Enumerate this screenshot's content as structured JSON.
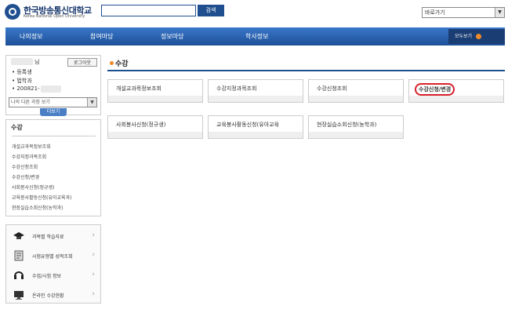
{
  "header": {
    "logo_title": "한국방송통신대학교",
    "logo_subtitle": "Korea National Open University",
    "search_button": "검색",
    "search_placeholder": "",
    "shortcut_select": "바로가기"
  },
  "nav": {
    "items": [
      "나의정보",
      "참여마당",
      "정보마당",
      "학사정보"
    ],
    "view_all": "모두보기"
  },
  "user": {
    "name_suffix": "님",
    "logout": "로그아웃",
    "info": [
      "• 등록생",
      "• 법학과",
      "• 200821-"
    ],
    "other_course_select": "나의 다른 과정 보기",
    "more": "더보기"
  },
  "left_menu": {
    "title": "수강",
    "items": [
      "개설교과목정보조회",
      "수강지정과목조회",
      "수강신청조회",
      "수강신청/변경",
      "사회봉사신청(정규생)",
      "교육봉사활동신청(유아교육과)",
      "현장실습소회신청(농학과)"
    ]
  },
  "quick_links": [
    {
      "label": "과목별 학습자료",
      "icon": "graduation-cap-icon"
    },
    {
      "label": "시험유형별 성적조회",
      "icon": "exam-paper-icon"
    },
    {
      "label": "수업/시험 정보",
      "icon": "headset-icon"
    },
    {
      "label": "온라인 수강현황",
      "icon": "monitor-icon"
    }
  ],
  "main": {
    "section_title": "수강",
    "cards": [
      "개설교과목정보조회",
      "수강지정과목조회",
      "수강신청조회",
      "수강신청/변경",
      "사회봉사신청(정규생)",
      "교육봉사활동신청(유아교육",
      "현장실습소회신청(농학과)"
    ]
  },
  "colors": {
    "nav_blue": "#1f4f8f",
    "accent_orange": "#f08a28",
    "highlight_red": "#d8202a"
  }
}
